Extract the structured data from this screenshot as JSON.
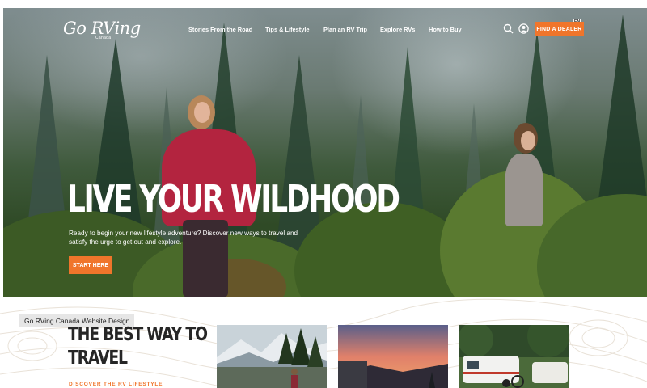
{
  "brand": {
    "logo_text": "Go RVing",
    "logo_sub": "Canada"
  },
  "nav": {
    "links": [
      "Stories From the Road",
      "Tips & Lifestyle",
      "Plan an RV Trip",
      "Explore RVs",
      "How to Buy"
    ],
    "language": "EN",
    "cta_label": "FIND A DEALER",
    "icons": [
      "search-icon",
      "user-icon"
    ]
  },
  "hero": {
    "title": "LIVE YOUR WILDHOOD",
    "body": "Ready to begin your new lifestyle adventure? Discover new ways to travel and satisfy the urge to get out and explore.",
    "cta_label": "START HERE"
  },
  "caption": "Go RVing Canada Website Design",
  "section": {
    "title_line1": "THE BEST WAY TO",
    "title_line2": "TRAVEL",
    "link_label": "DISCOVER THE RV LIFESTYLE"
  },
  "cards": [
    {
      "scene": "mountain-lake-photo"
    },
    {
      "scene": "sunset-rv-photo"
    },
    {
      "scene": "campground-rv-photo"
    }
  ],
  "colors": {
    "accent": "#f0752b",
    "forest": "#2f4a26",
    "text_dark": "#262626"
  }
}
